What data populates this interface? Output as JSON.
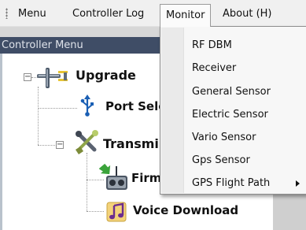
{
  "menubar": {
    "items": [
      {
        "label": "Menu"
      },
      {
        "label": "Controller Log"
      },
      {
        "label": "Monitor"
      },
      {
        "label": "About (H)"
      }
    ]
  },
  "panel": {
    "title": "Controller Menu",
    "tree": {
      "upgrade": {
        "label": "Upgrade",
        "icon": "plane-icon"
      },
      "port_select": {
        "label": "Port Sele",
        "icon": "usb-icon"
      },
      "transmitter": {
        "label": "Transmi",
        "icon": "tools-icon"
      },
      "firmware": {
        "label": "Firm",
        "icon": "transmitter-download-icon"
      },
      "voice_download": {
        "label": "Voice Download",
        "icon": "music-note-icon"
      }
    }
  },
  "monitor_menu": {
    "items": [
      {
        "label": "RF DBM"
      },
      {
        "label": "Receiver"
      },
      {
        "label": "General Sensor"
      },
      {
        "label": "Electric Sensor"
      },
      {
        "label": "Vario Sensor"
      },
      {
        "label": "Gps Sensor"
      },
      {
        "label": "GPS Flight Path",
        "has_submenu": true
      }
    ]
  },
  "colors": {
    "panel_title_bg": "#3f4d66",
    "menubar_bg": "#f0f0f0",
    "dropdown_bg": "#f7f7f7"
  }
}
